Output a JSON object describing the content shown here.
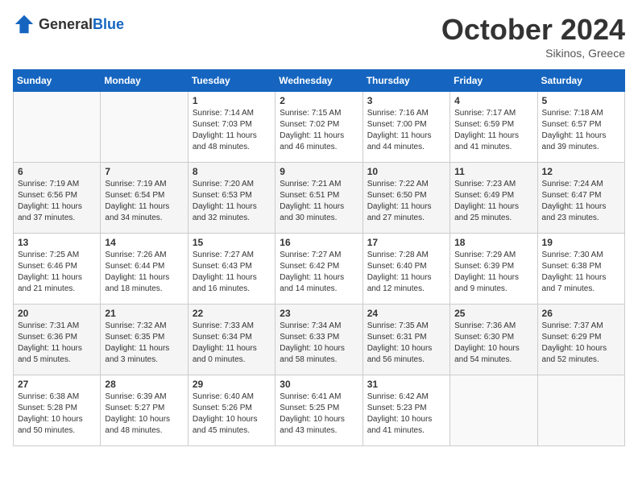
{
  "header": {
    "logo_general": "General",
    "logo_blue": "Blue",
    "month": "October 2024",
    "location": "Sikinos, Greece"
  },
  "days_of_week": [
    "Sunday",
    "Monday",
    "Tuesday",
    "Wednesday",
    "Thursday",
    "Friday",
    "Saturday"
  ],
  "weeks": [
    [
      {
        "day": "",
        "info": ""
      },
      {
        "day": "",
        "info": ""
      },
      {
        "day": "1",
        "info": "Sunrise: 7:14 AM\nSunset: 7:03 PM\nDaylight: 11 hours\nand 48 minutes."
      },
      {
        "day": "2",
        "info": "Sunrise: 7:15 AM\nSunset: 7:02 PM\nDaylight: 11 hours\nand 46 minutes."
      },
      {
        "day": "3",
        "info": "Sunrise: 7:16 AM\nSunset: 7:00 PM\nDaylight: 11 hours\nand 44 minutes."
      },
      {
        "day": "4",
        "info": "Sunrise: 7:17 AM\nSunset: 6:59 PM\nDaylight: 11 hours\nand 41 minutes."
      },
      {
        "day": "5",
        "info": "Sunrise: 7:18 AM\nSunset: 6:57 PM\nDaylight: 11 hours\nand 39 minutes."
      }
    ],
    [
      {
        "day": "6",
        "info": "Sunrise: 7:19 AM\nSunset: 6:56 PM\nDaylight: 11 hours\nand 37 minutes."
      },
      {
        "day": "7",
        "info": "Sunrise: 7:19 AM\nSunset: 6:54 PM\nDaylight: 11 hours\nand 34 minutes."
      },
      {
        "day": "8",
        "info": "Sunrise: 7:20 AM\nSunset: 6:53 PM\nDaylight: 11 hours\nand 32 minutes."
      },
      {
        "day": "9",
        "info": "Sunrise: 7:21 AM\nSunset: 6:51 PM\nDaylight: 11 hours\nand 30 minutes."
      },
      {
        "day": "10",
        "info": "Sunrise: 7:22 AM\nSunset: 6:50 PM\nDaylight: 11 hours\nand 27 minutes."
      },
      {
        "day": "11",
        "info": "Sunrise: 7:23 AM\nSunset: 6:49 PM\nDaylight: 11 hours\nand 25 minutes."
      },
      {
        "day": "12",
        "info": "Sunrise: 7:24 AM\nSunset: 6:47 PM\nDaylight: 11 hours\nand 23 minutes."
      }
    ],
    [
      {
        "day": "13",
        "info": "Sunrise: 7:25 AM\nSunset: 6:46 PM\nDaylight: 11 hours\nand 21 minutes."
      },
      {
        "day": "14",
        "info": "Sunrise: 7:26 AM\nSunset: 6:44 PM\nDaylight: 11 hours\nand 18 minutes."
      },
      {
        "day": "15",
        "info": "Sunrise: 7:27 AM\nSunset: 6:43 PM\nDaylight: 11 hours\nand 16 minutes."
      },
      {
        "day": "16",
        "info": "Sunrise: 7:27 AM\nSunset: 6:42 PM\nDaylight: 11 hours\nand 14 minutes."
      },
      {
        "day": "17",
        "info": "Sunrise: 7:28 AM\nSunset: 6:40 PM\nDaylight: 11 hours\nand 12 minutes."
      },
      {
        "day": "18",
        "info": "Sunrise: 7:29 AM\nSunset: 6:39 PM\nDaylight: 11 hours\nand 9 minutes."
      },
      {
        "day": "19",
        "info": "Sunrise: 7:30 AM\nSunset: 6:38 PM\nDaylight: 11 hours\nand 7 minutes."
      }
    ],
    [
      {
        "day": "20",
        "info": "Sunrise: 7:31 AM\nSunset: 6:36 PM\nDaylight: 11 hours\nand 5 minutes."
      },
      {
        "day": "21",
        "info": "Sunrise: 7:32 AM\nSunset: 6:35 PM\nDaylight: 11 hours\nand 3 minutes."
      },
      {
        "day": "22",
        "info": "Sunrise: 7:33 AM\nSunset: 6:34 PM\nDaylight: 11 hours\nand 0 minutes."
      },
      {
        "day": "23",
        "info": "Sunrise: 7:34 AM\nSunset: 6:33 PM\nDaylight: 10 hours\nand 58 minutes."
      },
      {
        "day": "24",
        "info": "Sunrise: 7:35 AM\nSunset: 6:31 PM\nDaylight: 10 hours\nand 56 minutes."
      },
      {
        "day": "25",
        "info": "Sunrise: 7:36 AM\nSunset: 6:30 PM\nDaylight: 10 hours\nand 54 minutes."
      },
      {
        "day": "26",
        "info": "Sunrise: 7:37 AM\nSunset: 6:29 PM\nDaylight: 10 hours\nand 52 minutes."
      }
    ],
    [
      {
        "day": "27",
        "info": "Sunrise: 6:38 AM\nSunset: 5:28 PM\nDaylight: 10 hours\nand 50 minutes."
      },
      {
        "day": "28",
        "info": "Sunrise: 6:39 AM\nSunset: 5:27 PM\nDaylight: 10 hours\nand 48 minutes."
      },
      {
        "day": "29",
        "info": "Sunrise: 6:40 AM\nSunset: 5:26 PM\nDaylight: 10 hours\nand 45 minutes."
      },
      {
        "day": "30",
        "info": "Sunrise: 6:41 AM\nSunset: 5:25 PM\nDaylight: 10 hours\nand 43 minutes."
      },
      {
        "day": "31",
        "info": "Sunrise: 6:42 AM\nSunset: 5:23 PM\nDaylight: 10 hours\nand 41 minutes."
      },
      {
        "day": "",
        "info": ""
      },
      {
        "day": "",
        "info": ""
      }
    ]
  ]
}
